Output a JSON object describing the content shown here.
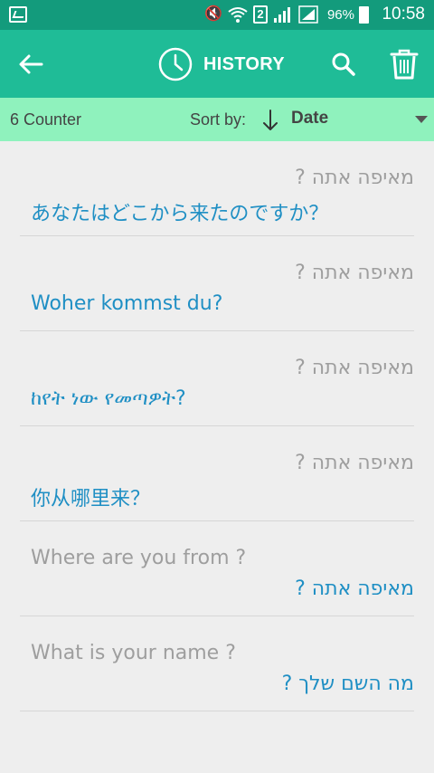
{
  "status_bar": {
    "sim_slot": "2",
    "battery": "96%",
    "time": "10:58"
  },
  "app_bar": {
    "title": "HISTORY"
  },
  "sort_bar": {
    "counter": "6 Counter",
    "sort_label": "Sort by:",
    "sort_value": "Date"
  },
  "history": [
    {
      "source": "מאיפה אתה ?",
      "translation": "あなたはどこから来たのですか？"
    },
    {
      "source": "מאיפה אתה ?",
      "translation": "Woher kommst du?"
    },
    {
      "source": "מאיפה אתה ?",
      "translation": "ከየት ነው የመጣዎት?"
    },
    {
      "source": "מאיפה אתה ?",
      "translation": "你从哪里来？"
    },
    {
      "source": "Where are you from ?",
      "translation": "מאיפה אתה ?"
    },
    {
      "source": "What is your name ?",
      "translation": "מה השם שלך ?"
    }
  ],
  "colors": {
    "status_bar": "#139b7c",
    "app_bar": "#1fbc97",
    "sort_bar": "#8ff2bd",
    "translation_text": "#1f8fc4",
    "source_text": "#9e9e9e"
  },
  "icons": [
    "gallery-icon",
    "mute-icon",
    "wifi-icon",
    "signal-icon",
    "battery-icon",
    "back-arrow-icon",
    "clock-icon",
    "search-icon",
    "trash-icon",
    "sort-down-arrow-icon",
    "dropdown-caret-icon"
  ]
}
